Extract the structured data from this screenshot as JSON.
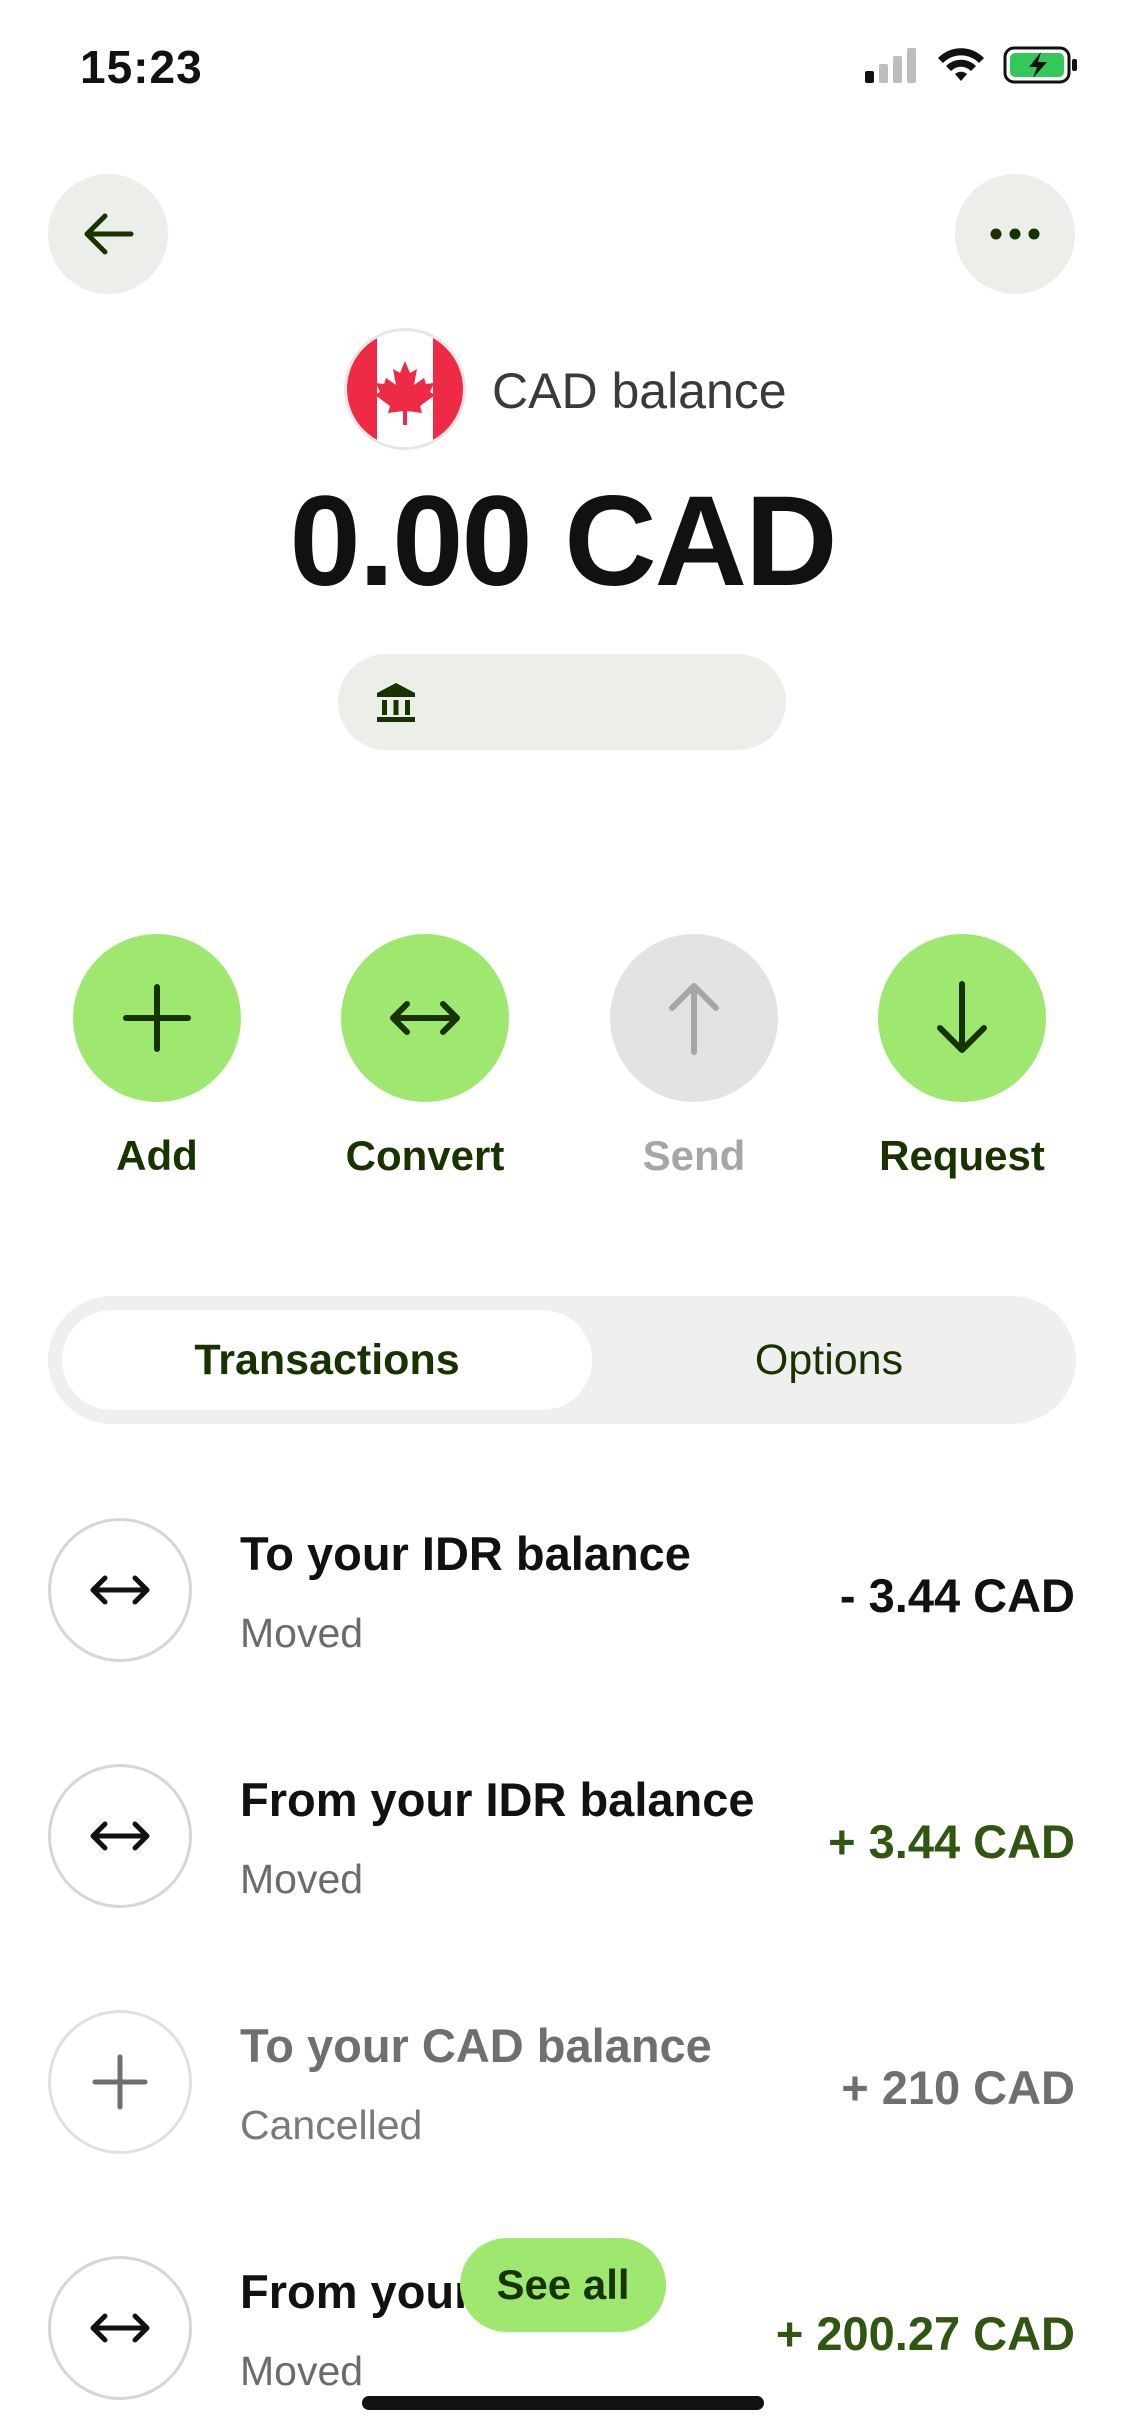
{
  "status_bar": {
    "time": "15:23"
  },
  "balance": {
    "label": "CAD balance",
    "amount": "0.00 CAD",
    "flag_icon": "canada-flag-icon"
  },
  "actions": [
    {
      "label": "Add",
      "icon": "plus-icon",
      "enabled": true
    },
    {
      "label": "Convert",
      "icon": "convert-arrows-icon",
      "enabled": true
    },
    {
      "label": "Send",
      "icon": "arrow-up-icon",
      "enabled": false
    },
    {
      "label": "Request",
      "icon": "arrow-down-icon",
      "enabled": true
    }
  ],
  "tabs": [
    {
      "label": "Transactions",
      "active": true
    },
    {
      "label": "Options",
      "active": false
    }
  ],
  "transactions": [
    {
      "title": "To your IDR balance",
      "status": "Moved",
      "amount": "- 3.44 CAD",
      "icon": "convert-arrows-icon"
    },
    {
      "title": "From your IDR balance",
      "status": "Moved",
      "amount": "+ 3.44 CAD",
      "icon": "convert-arrows-icon"
    },
    {
      "title": "To your CAD balance",
      "status": "Cancelled",
      "amount": "+ 210 CAD",
      "icon": "plus-icon"
    },
    {
      "title": "From your ...",
      "status": "Moved",
      "amount": "+ 200.27 CAD",
      "icon": "convert-arrows-icon"
    }
  ],
  "see_all_label": "See all",
  "colors": {
    "accent_green": "#9fe870",
    "dark_green": "#163300",
    "positive_amount": "#2f5711"
  }
}
